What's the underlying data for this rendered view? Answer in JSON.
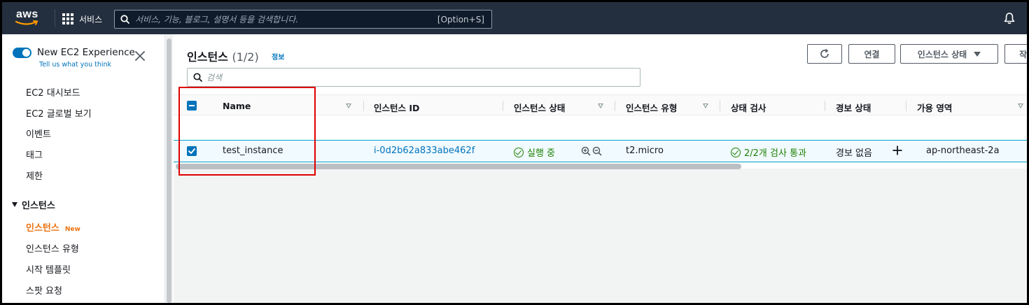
{
  "topnav": {
    "logo": "aws",
    "services_label": "서비스",
    "search_placeholder": "서비스, 기능, 블로그, 설명서 등을 검색합니다.",
    "search_shortcut": "[Option+S]"
  },
  "sidebar": {
    "new_experience_title": "New EC2 Experience",
    "new_experience_link": "Tell us what you think",
    "top_items": [
      "EC2 대시보드",
      "EC2 글로벌 보기",
      "이벤트",
      "태그",
      "제한"
    ],
    "section_title": "인스턴스",
    "section_items": [
      {
        "label": "인스턴스",
        "badge": "New",
        "active": true
      },
      {
        "label": "인스턴스 유형"
      },
      {
        "label": "시작 템플릿"
      },
      {
        "label": "스팟 요청"
      }
    ]
  },
  "main": {
    "title": "인스턴스",
    "count": "(1/2)",
    "info_link": "정보",
    "connect_button": "연결",
    "instance_state_button": "인스턴스 상태",
    "actions_button_partial": "작",
    "search_placeholder": "검색",
    "columns": [
      "Name",
      "인스턴스 ID",
      "인스턴스 상태",
      "인스턴스 유형",
      "상태 검사",
      "경보 상태",
      "가용 영역"
    ],
    "rows": [
      {
        "name": "test_instance",
        "instance_id": "i-0d2b62a833abe462f",
        "state": "실행 중",
        "type": "t2.micro",
        "status_check": "2/2개 검사 통과",
        "alarm_status": "경보 없음",
        "availability_zone": "ap-northeast-2a",
        "selected": true
      }
    ]
  },
  "colors": {
    "nav_bg": "#232f3e",
    "accent_blue": "#0073bb",
    "active_orange": "#ec7211",
    "success_green": "#1d8102",
    "highlight_red": "#e00000"
  }
}
